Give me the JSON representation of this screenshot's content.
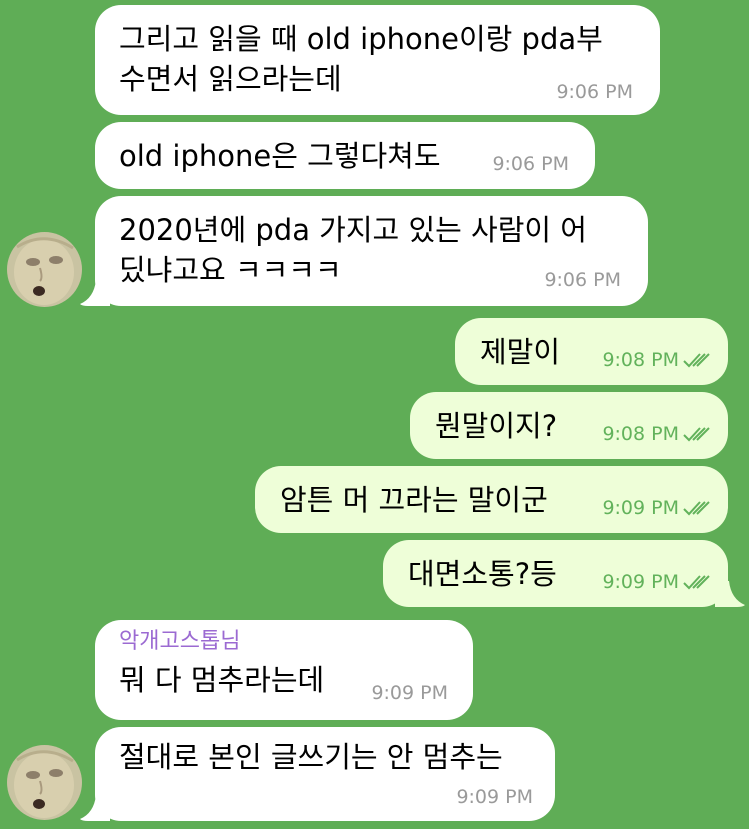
{
  "messages": [
    {
      "text": "그리고 읽을 때 old iphone이랑 pda부\n수면서 읽으라는데",
      "time": "9:06 PM"
    },
    {
      "text": "old iphone은 그렇다쳐도",
      "time": "9:06 PM"
    },
    {
      "text": "2020년에 pda 가지고 있는 사람이 어\n딨냐고요 ㅋㅋㅋㅋ",
      "time": "9:06 PM"
    },
    {
      "text": "제말이",
      "time": "9:08 PM"
    },
    {
      "text": "뭔말이지?",
      "time": "9:08 PM"
    },
    {
      "text": "암튼 머 끄라는 말이군",
      "time": "9:09 PM"
    },
    {
      "text": "대면소통?등",
      "time": "9:09 PM"
    },
    {
      "sender": "악개고스톱님",
      "text": "뭐 다 멈추라는데",
      "time": "9:09 PM"
    },
    {
      "text": "절대로 본인 글쓰기는 안 멈추는",
      "time": "9:09 PM"
    }
  ],
  "colors": {
    "background": "#5fad56",
    "incoming_bubble": "#ffffff",
    "outgoing_bubble": "#eefed8",
    "read_check": "#62b25b",
    "sender_name": "#9b6ad2"
  },
  "icons": {
    "read_status": "double-check-icon",
    "avatar": "user-avatar"
  }
}
